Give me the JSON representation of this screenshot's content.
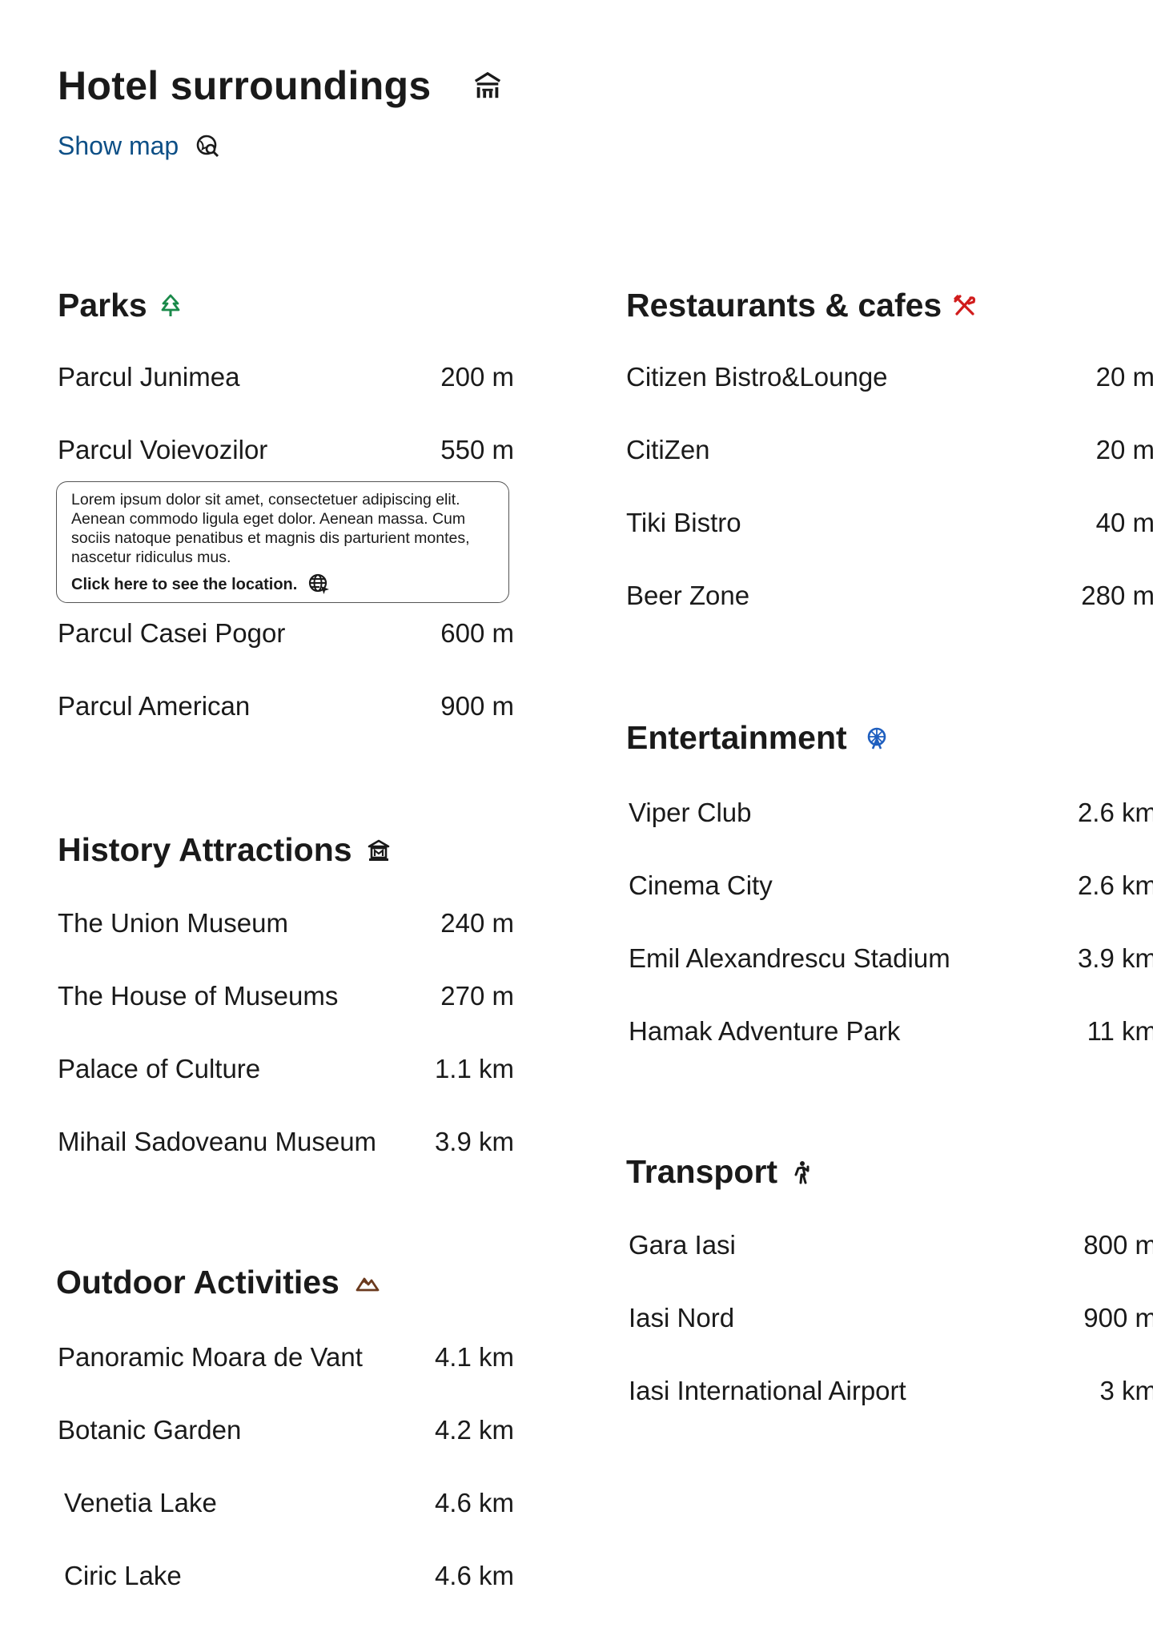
{
  "header": {
    "title": "Hotel surroundings",
    "show_map": "Show map"
  },
  "colors": {
    "link": "#0d4f86",
    "parks": "#1a8a4a",
    "restaurants": "#d11c1c",
    "entertainment": "#1f5fbf",
    "outdoor": "#6b3a1e"
  },
  "icons": {
    "title": "hotel-building-icon",
    "show_map": "map-search-icon",
    "parks": "tree-icon",
    "restaurants": "fork-knife-icon",
    "entertainment": "ferris-wheel-icon",
    "history": "museum-icon",
    "transport": "walking-person-icon",
    "outdoor": "mountain-icon",
    "tooltip_link": "globe-pointer-icon"
  },
  "parks": {
    "title": "Parks",
    "items": [
      {
        "name": "Parcul Junimea",
        "distance": "200 m"
      },
      {
        "name": "Parcul Voievozilor",
        "distance": "550 m"
      },
      {
        "name": "Parcul Casei Pogor",
        "distance": "600 m"
      },
      {
        "name": "Parcul American",
        "distance": "900 m"
      }
    ]
  },
  "tooltip": {
    "text": "Lorem ipsum dolor sit amet, consectetuer adipiscing elit. Aenean commodo ligula eget dolor. Aenean massa. Cum sociis natoque penatibus et magnis dis parturient montes, nascetur ridiculus mus.",
    "link": "Click here to see the location."
  },
  "restaurants": {
    "title": "Restaurants & cafes",
    "items": [
      {
        "name": "Citizen Bistro&Lounge",
        "distance": "20 m"
      },
      {
        "name": "CitiZen",
        "distance": "20 m"
      },
      {
        "name": "Tiki Bistro",
        "distance": "40 m"
      },
      {
        "name": "Beer Zone",
        "distance": "280 m"
      }
    ]
  },
  "entertainment": {
    "title": "Entertainment",
    "items": [
      {
        "name": "Viper Club",
        "distance": "2.6 km"
      },
      {
        "name": "Cinema City",
        "distance": "2.6 km"
      },
      {
        "name": "Emil Alexandrescu Stadium",
        "distance": "3.9 km"
      },
      {
        "name": "Hamak Adventure Park",
        "distance": "11 km"
      }
    ]
  },
  "history": {
    "title": "History Attractions",
    "items": [
      {
        "name": "The Union Museum",
        "distance": "240 m"
      },
      {
        "name": "The House of Museums",
        "distance": "270 m"
      },
      {
        "name": "Palace of Culture",
        "distance": "1.1 km"
      },
      {
        "name": "Mihail Sadoveanu Museum",
        "distance": "3.9 km"
      }
    ]
  },
  "transport": {
    "title": "Transport",
    "items": [
      {
        "name": "Gara Iasi",
        "distance": "800 m"
      },
      {
        "name": "Iasi Nord",
        "distance": "900 m"
      },
      {
        "name": "Iasi International Airport",
        "distance": "3 km"
      }
    ]
  },
  "outdoor": {
    "title": "Outdoor Activities",
    "items": [
      {
        "name": "Panoramic Moara de Vant",
        "distance": "4.1 km"
      },
      {
        "name": "Botanic Garden",
        "distance": "4.2 km"
      },
      {
        "name": "Venetia Lake",
        "distance": "4.6 km"
      },
      {
        "name": "Ciric Lake",
        "distance": "4.6 km"
      }
    ]
  }
}
